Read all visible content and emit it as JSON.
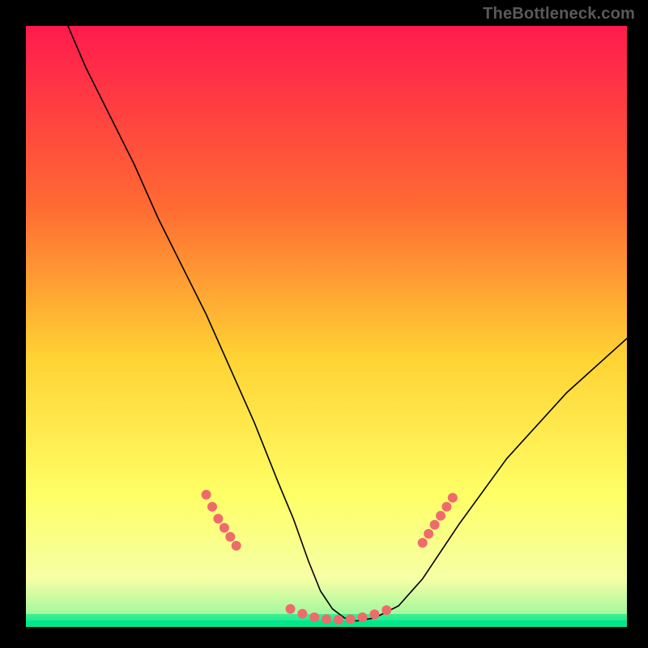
{
  "watermark": "TheBottleneck.com",
  "chart_data": {
    "type": "line",
    "title": "",
    "xlabel": "",
    "ylabel": "",
    "xlim": [
      0,
      100
    ],
    "ylim": [
      0,
      100
    ],
    "grid": false,
    "legend": false,
    "background_gradient": {
      "top": "#ff1a4d",
      "mid1": "#ff6a33",
      "mid2": "#ffd233",
      "mid3": "#ffff66",
      "bottom_band": "#f5ffa6",
      "bottom_edge": "#00e88b"
    },
    "series": [
      {
        "name": "bottleneck-curve",
        "color": "#000000",
        "x": [
          7,
          10,
          14,
          18,
          22,
          26,
          30,
          34,
          38,
          42,
          44.5,
          47,
          49,
          51,
          53,
          55,
          58,
          62,
          66,
          72,
          80,
          90,
          100
        ],
        "y": [
          100,
          93,
          85,
          77,
          68,
          60,
          52,
          43,
          34,
          24,
          18,
          11,
          6,
          3,
          1.5,
          1,
          1.5,
          3.5,
          8,
          17,
          28,
          39,
          48
        ]
      },
      {
        "name": "highlight-dots-left",
        "color": "#ef6b6b",
        "style": "scatter",
        "x": [
          30,
          31,
          32,
          33,
          34,
          35
        ],
        "y": [
          22,
          20,
          18,
          16.5,
          15,
          13.5
        ]
      },
      {
        "name": "highlight-dots-bottom",
        "color": "#ef6b6b",
        "style": "scatter",
        "x": [
          44,
          46,
          48,
          50,
          52,
          54,
          56,
          58,
          60
        ],
        "y": [
          3,
          2.2,
          1.6,
          1.3,
          1.2,
          1.3,
          1.6,
          2.1,
          2.8
        ]
      },
      {
        "name": "highlight-dots-right",
        "color": "#ef6b6b",
        "style": "scatter",
        "x": [
          66,
          67,
          68,
          69,
          70,
          71
        ],
        "y": [
          14,
          15.5,
          17,
          18.5,
          20,
          21.5
        ]
      }
    ]
  }
}
